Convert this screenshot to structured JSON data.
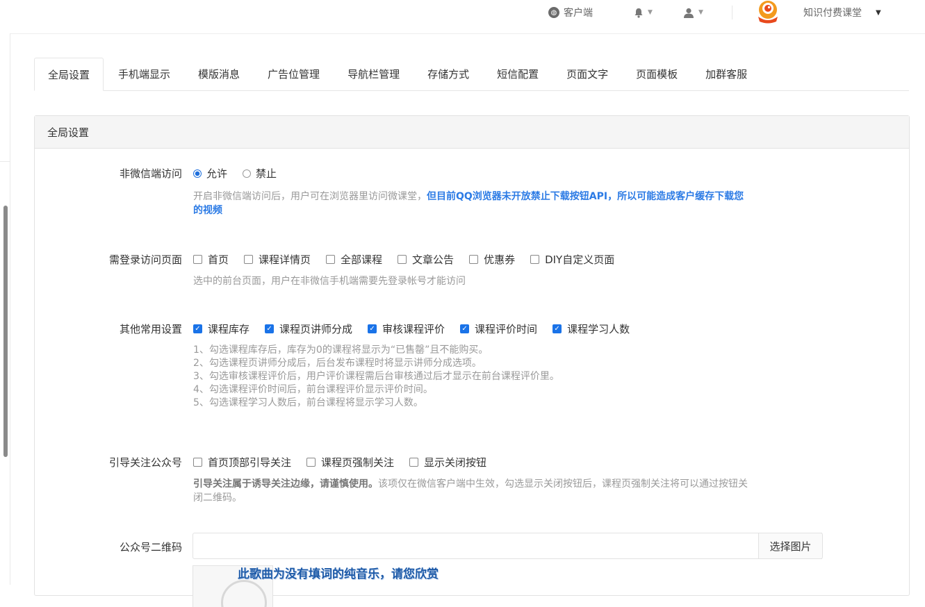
{
  "topbar": {
    "client_label": "客户端",
    "account_name": "知识付费课堂"
  },
  "tabs": [
    {
      "label": "全局设置",
      "active": true
    },
    {
      "label": "手机端显示"
    },
    {
      "label": "模版消息"
    },
    {
      "label": "广告位管理"
    },
    {
      "label": "导航栏管理"
    },
    {
      "label": "存储方式"
    },
    {
      "label": "短信配置"
    },
    {
      "label": "页面文字"
    },
    {
      "label": "页面模板"
    },
    {
      "label": "加群客服"
    }
  ],
  "panel": {
    "title": "全局设置",
    "non_wechat": {
      "label": "非微信端访问",
      "options": [
        "允许",
        "禁止"
      ],
      "selected": "允许",
      "help_plain": "开启非微信端访问后，用户可在浏览器里访问微课堂，",
      "help_bold_1": "但目前QQ浏览器未开放禁止下载按钮API，所以可能造成客户缓存下载您",
      "help_bold_2": "的视频"
    },
    "login_pages": {
      "label": "需登录访问页面",
      "options": [
        "首页",
        "课程详情页",
        "全部课程",
        "文章公告",
        "优惠券",
        "DIY自定义页面"
      ],
      "help": "选中的前台页面，用户在非微信手机端需要先登录帐号才能访问"
    },
    "common": {
      "label": "其他常用设置",
      "options": [
        "课程库存",
        "课程页讲师分成",
        "审核课程评价",
        "课程评价时间",
        "课程学习人数"
      ],
      "help": [
        "1、勾选课程库存后，库存为0的课程将显示为“已售罄”且不能购买。",
        "2、勾选课程页讲师分成后，后台发布课程时将显示讲师分成选项。",
        "3、勾选审核课程评价后，用户评价课程需后台审核通过后才显示在前台课程评价里。",
        "4、勾选课程评价时间后，前台课程评价显示评价时间。",
        "5、勾选课程学习人数后，前台课程将显示学习人数。"
      ]
    },
    "follow": {
      "label": "引导关注公众号",
      "options": [
        "首页顶部引导关注",
        "课程页强制关注",
        "显示关闭按钮"
      ],
      "help_bold": "引导关注属于诱导关注边缘，请谨慎使用。",
      "help_1": "该项仅在微信客户端中生效，勾选显示关闭按钮后，课程页强制关注将可以通过按钮关",
      "help_2": "闭二维码。"
    },
    "qrcode": {
      "label": "公众号二维码",
      "input_value": "",
      "button": "选择图片"
    }
  },
  "overlay_subtitle": "此歌曲为没有填词的纯音乐，请您欣赏",
  "colors": {
    "accent": "#1a73e8",
    "link_blue": "#2c7be5"
  }
}
